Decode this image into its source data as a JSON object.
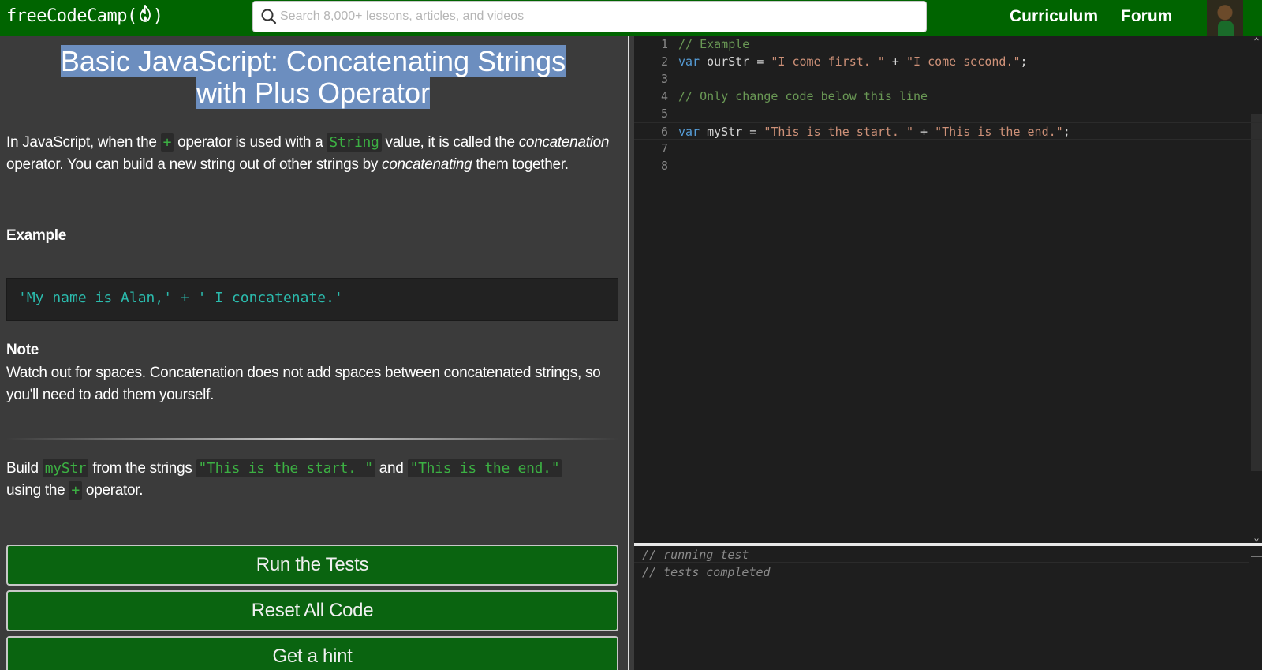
{
  "navbar": {
    "logo_prefix": "freeCodeCamp(",
    "logo_suffix": ")",
    "logo_icon": "flame-icon",
    "search_placeholder": "Search 8,000+ lessons, articles, and videos",
    "search_icon": "search-icon",
    "links": [
      "Curriculum",
      "Forum"
    ],
    "avatar_icon": "user-avatar"
  },
  "challenge": {
    "title": "Basic JavaScript: Concatenating Strings with Plus Operator",
    "p1": {
      "t1": "In JavaScript, when the ",
      "c1": "+",
      "t2": " operator is used with a ",
      "c2": "String",
      "t3": " value, it is called the ",
      "e1": "concatenation",
      "t4": " operator. You can build a new string out of other strings by ",
      "e2": "concatenating",
      "t5": " them together."
    },
    "example_heading": "Example",
    "example_code": "'My name is Alan,' + ' I concatenate.'",
    "note_heading": "Note",
    "note_text": "Watch out for spaces. Concatenation does not add spaces between concatenated strings, so you'll need to add them yourself.",
    "task": {
      "t1": "Build ",
      "c1": "myStr",
      "t2": " from the strings ",
      "c2": "\"This is the start. \"",
      "t3": " and ",
      "c3": "\"This is the end.\"",
      "t4": " using the ",
      "c4": "+",
      "t5": " operator."
    },
    "buttons": {
      "run": "Run the Tests",
      "reset": "Reset All Code",
      "hint": "Get a hint"
    }
  },
  "editor": {
    "lines": [
      {
        "num": "1",
        "tokens": [
          {
            "t": "// Example",
            "k": "comment"
          }
        ]
      },
      {
        "num": "2",
        "tokens": [
          {
            "t": "var",
            "k": "keyword"
          },
          {
            "t": " ourStr = ",
            "k": "plain"
          },
          {
            "t": "\"I come first. \"",
            "k": "string"
          },
          {
            "t": " + ",
            "k": "plain"
          },
          {
            "t": "\"I come second.\"",
            "k": "string"
          },
          {
            "t": ";",
            "k": "plain"
          }
        ]
      },
      {
        "num": "3",
        "tokens": []
      },
      {
        "num": "4",
        "tokens": [
          {
            "t": "// Only change code below this line",
            "k": "comment"
          }
        ]
      },
      {
        "num": "5",
        "tokens": []
      },
      {
        "num": "6",
        "tokens": [
          {
            "t": "var",
            "k": "keyword"
          },
          {
            "t": " myStr = ",
            "k": "plain"
          },
          {
            "t": "\"This is the start. \"",
            "k": "string"
          },
          {
            "t": " + ",
            "k": "plain"
          },
          {
            "t": "\"This is the end.\"",
            "k": "string"
          },
          {
            "t": ";",
            "k": "plain"
          }
        ]
      },
      {
        "num": "7",
        "tokens": []
      },
      {
        "num": "8",
        "tokens": []
      }
    ],
    "current_line": 6
  },
  "output": {
    "lines": [
      "// running test",
      "// tests completed"
    ]
  },
  "colors": {
    "navbar_bg": "#006400",
    "button_bg": "#0a6410",
    "title_highlight": "#6c8ebf",
    "inline_code": "#3cb043",
    "example_code": "#2bbbad"
  }
}
